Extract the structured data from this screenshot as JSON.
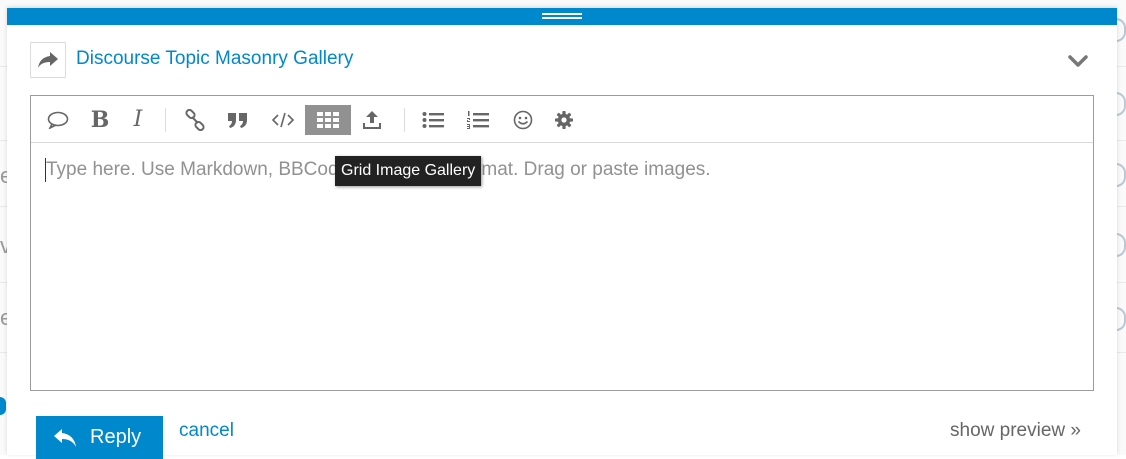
{
  "composer": {
    "topic_title": "Discourse Topic Masonry Gallery",
    "placeholder": "Type here. Use Markdown, BBCode, or HTML to format. Drag or paste images.",
    "tooltip": "Grid Image Gallery",
    "toolbar": [
      {
        "name": "quote-icon",
        "active": false
      },
      {
        "name": "bold-icon",
        "active": false
      },
      {
        "name": "italic-icon",
        "active": false
      },
      {
        "name": "link-icon",
        "active": false
      },
      {
        "name": "blockquote-icon",
        "active": false
      },
      {
        "name": "code-icon",
        "active": false
      },
      {
        "name": "grid-gallery-icon",
        "active": true
      },
      {
        "name": "upload-icon",
        "active": false
      },
      {
        "name": "bullet-list-icon",
        "active": false
      },
      {
        "name": "numbered-list-icon",
        "active": false
      },
      {
        "name": "emoji-icon",
        "active": false
      },
      {
        "name": "gear-icon",
        "active": false
      }
    ],
    "reply_label": "Reply",
    "cancel_label": "cancel",
    "preview_label": "show preview »"
  },
  "background": {
    "left_letters": [
      "e",
      "v",
      "e"
    ]
  },
  "colors": {
    "accent": "#0088cc",
    "tooltip_bg": "#222222",
    "active_button": "#919191"
  }
}
